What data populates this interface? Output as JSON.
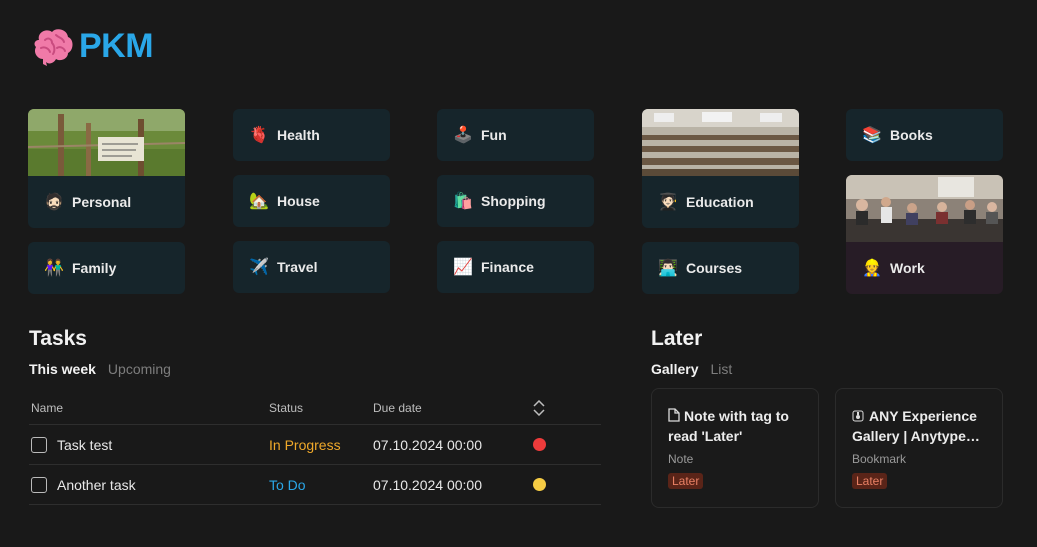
{
  "header": {
    "title": "PKM",
    "icon": "brain-icon"
  },
  "cards": [
    {
      "id": "personal",
      "label": "Personal",
      "emoji": "🧔🏻"
    },
    {
      "id": "family",
      "label": "Family",
      "emoji": "👫"
    },
    {
      "id": "health",
      "label": "Health",
      "emoji": "🫀"
    },
    {
      "id": "house",
      "label": "House",
      "emoji": "🏡"
    },
    {
      "id": "travel",
      "label": "Travel",
      "emoji": "✈️"
    },
    {
      "id": "fun",
      "label": "Fun",
      "emoji": "🕹️"
    },
    {
      "id": "shopping",
      "label": "Shopping",
      "emoji": "🛍️"
    },
    {
      "id": "finance",
      "label": "Finance",
      "emoji": "📈"
    },
    {
      "id": "education",
      "label": "Education",
      "emoji": "🧑🏻‍🎓"
    },
    {
      "id": "courses",
      "label": "Courses",
      "emoji": "👨🏻‍💻"
    },
    {
      "id": "books",
      "label": "Books",
      "emoji": "📚"
    },
    {
      "id": "work",
      "label": "Work",
      "emoji": "👷"
    }
  ],
  "tasks": {
    "title": "Tasks",
    "tabs": [
      {
        "label": "This week"
      },
      {
        "label": "Upcoming"
      }
    ],
    "columns": {
      "name": "Name",
      "status": "Status",
      "due": "Due date"
    },
    "rows": [
      {
        "name": "Task test",
        "status": "In Progress",
        "status_color": "#f0a92a",
        "due": "07.10.2024 00:00",
        "priority_color": "#ee3b3b"
      },
      {
        "name": "Another task",
        "status": "To Do",
        "status_color": "#2aa7e8",
        "due": "07.10.2024 00:00",
        "priority_color": "#f6cc44"
      }
    ]
  },
  "later": {
    "title": "Later",
    "tabs": [
      {
        "label": "Gallery"
      },
      {
        "label": "List"
      }
    ],
    "items": [
      {
        "title": "Note with tag to read 'Later'",
        "type": "Note",
        "tag": "Later",
        "icon": "document-icon"
      },
      {
        "title": "ANY Experience Gallery | Anytype…",
        "type": "Bookmark",
        "tag": "Later",
        "icon": "bookmark-favicon-icon"
      }
    ]
  },
  "colors": {
    "accent": "#2aa7e8",
    "card_bg": "#16252b",
    "work_card_bg": "#271c26",
    "tag_bg": "#5a2418",
    "tag_text": "#e88064"
  }
}
